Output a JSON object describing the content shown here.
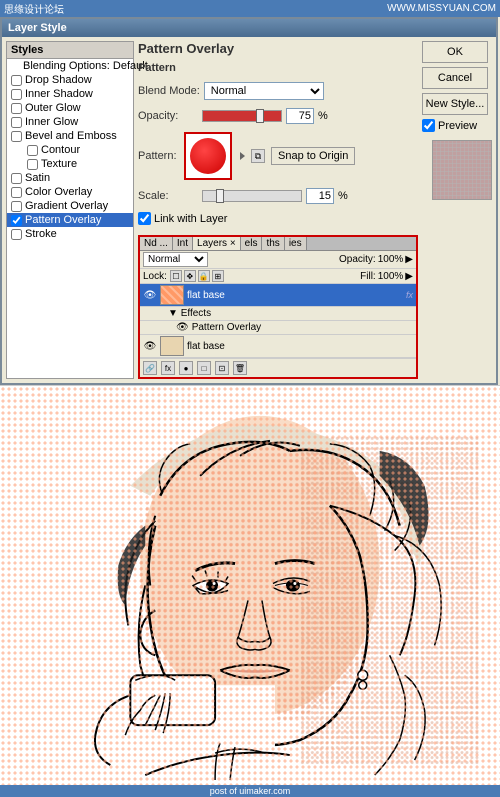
{
  "watermark": {
    "left": "思缘设计论坛",
    "right": "WWW.MISSYUAN.COM"
  },
  "dialog": {
    "title": "Layer Style",
    "styles_label": "Styles",
    "styles": [
      {
        "id": "styles",
        "label": "Styles",
        "type": "header"
      },
      {
        "id": "blending-options",
        "label": "Blending Options: Default",
        "type": "item",
        "checked": false
      },
      {
        "id": "drop-shadow",
        "label": "Drop Shadow",
        "type": "checkbox",
        "checked": false
      },
      {
        "id": "inner-shadow",
        "label": "Inner Shadow",
        "type": "checkbox",
        "checked": false
      },
      {
        "id": "outer-glow",
        "label": "Outer Glow",
        "type": "checkbox",
        "checked": false
      },
      {
        "id": "inner-glow",
        "label": "Inner Glow",
        "type": "checkbox",
        "checked": false
      },
      {
        "id": "bevel-emboss",
        "label": "Bevel and Emboss",
        "type": "checkbox",
        "checked": false
      },
      {
        "id": "contour",
        "label": "Contour",
        "type": "checkbox-indent",
        "checked": false
      },
      {
        "id": "texture",
        "label": "Texture",
        "type": "checkbox-indent",
        "checked": false
      },
      {
        "id": "satin",
        "label": "Satin",
        "type": "checkbox",
        "checked": false
      },
      {
        "id": "color-overlay",
        "label": "Color Overlay",
        "type": "checkbox",
        "checked": false
      },
      {
        "id": "gradient-overlay",
        "label": "Gradient Overlay",
        "type": "checkbox",
        "checked": false
      },
      {
        "id": "pattern-overlay",
        "label": "Pattern Overlay",
        "type": "checkbox",
        "checked": true,
        "active": true
      },
      {
        "id": "stroke",
        "label": "Stroke",
        "type": "checkbox",
        "checked": false
      }
    ],
    "section_title": "Pattern Overlay",
    "pattern_label": "Pattern",
    "blend_mode_label": "Blend Mode:",
    "blend_mode_value": "Normal",
    "opacity_label": "Opacity:",
    "opacity_value": "75",
    "percent": "%",
    "pattern_label2": "Pattern:",
    "snap_to_origin": "Snap to Origin",
    "scale_label": "Scale:",
    "scale_value": "15",
    "link_with_layer": "Link with Layer",
    "ok_label": "OK",
    "cancel_label": "Cancel",
    "new_style_label": "New Style...",
    "preview_label": "Preview"
  },
  "inner_panel": {
    "tabs": [
      "Nd ...",
      "Int",
      "Layers",
      "×",
      "els",
      "ths",
      "ies"
    ],
    "blend_mode": "Normal",
    "opacity_label": "Opacity:",
    "opacity_value": "100%",
    "lock_label": "Lock:",
    "fill_label": "Fill:",
    "fill_value": "100%",
    "layer1_name": "flat base",
    "layer1_fx": "fx",
    "effects_label": "Effects",
    "pattern_overlay_label": "Pattern Overlay",
    "layer2_name": "flat base"
  },
  "bottom_watermark": "post of uimaker.com"
}
